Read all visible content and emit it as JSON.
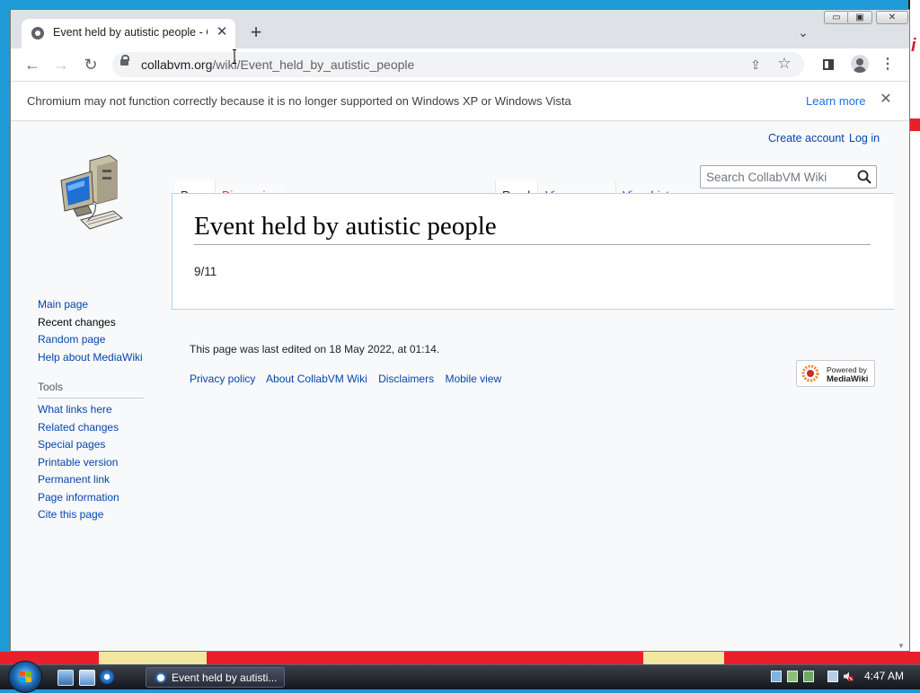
{
  "browser": {
    "tab_title": "Event held by autistic people - C",
    "new_tab_label": "+",
    "tab_close_glyph": "✕",
    "tab_search_glyph": "⌄",
    "url_host": "collabvm.org",
    "url_path": "/wiki/Event_held_by_autistic_people",
    "window_buttons": {
      "minimize": "▭",
      "restore": "▣",
      "close": "✕"
    },
    "nav_glyphs": {
      "back": "←",
      "forward": "→",
      "reload": "↻",
      "menu": "⋮",
      "share": "⇪",
      "star": "☆"
    }
  },
  "infobar": {
    "message": "Chromium may not function correctly because it is no longer supported on Windows XP or Windows Vista",
    "learn_more": "Learn more",
    "close_glyph": "✕"
  },
  "wiki": {
    "personal": {
      "create_account": "Create account",
      "log_in": "Log in"
    },
    "namespace_tabs": {
      "page": "Page",
      "discussion": "Discussion"
    },
    "view_tabs": {
      "read": "Read",
      "view_source": "View source",
      "view_history": "View history"
    },
    "search_placeholder": "Search CollabVM Wiki",
    "navigation": [
      "Main page",
      "Recent changes",
      "Random page",
      "Help about MediaWiki"
    ],
    "tools_heading": "Tools",
    "tools": [
      "What links here",
      "Related changes",
      "Special pages",
      "Printable version",
      "Permanent link",
      "Page information",
      "Cite this page"
    ],
    "page_title": "Event held by autistic people",
    "page_body": "9/11",
    "last_edited": "This page was last edited on 18 May 2022, at 01:14.",
    "footer_links": [
      "Privacy policy",
      "About CollabVM Wiki",
      "Disclaimers",
      "Mobile view"
    ],
    "powered_by": {
      "line1": "Powered by",
      "line2": "MediaWiki"
    }
  },
  "taskbar": {
    "task_label": "Event held by autisti...",
    "clock": "4:47 AM"
  },
  "colors": {
    "link": "#0645ad",
    "discussion_red": "#d33",
    "chrome_link": "#1a73e8",
    "desktop_blue": "#1e9bd7"
  },
  "icons": [
    "chromium-favicon",
    "lock-icon",
    "share-icon",
    "star-icon",
    "side-panel-icon",
    "profile-icon",
    "menu-icon",
    "search-icon",
    "computer-logo",
    "mediawiki-flower-icon",
    "start-orb",
    "windows-flag-icon",
    "show-desktop-icon",
    "switch-windows-icon",
    "ie-icon",
    "volume-muted-icon",
    "network-icon"
  ]
}
